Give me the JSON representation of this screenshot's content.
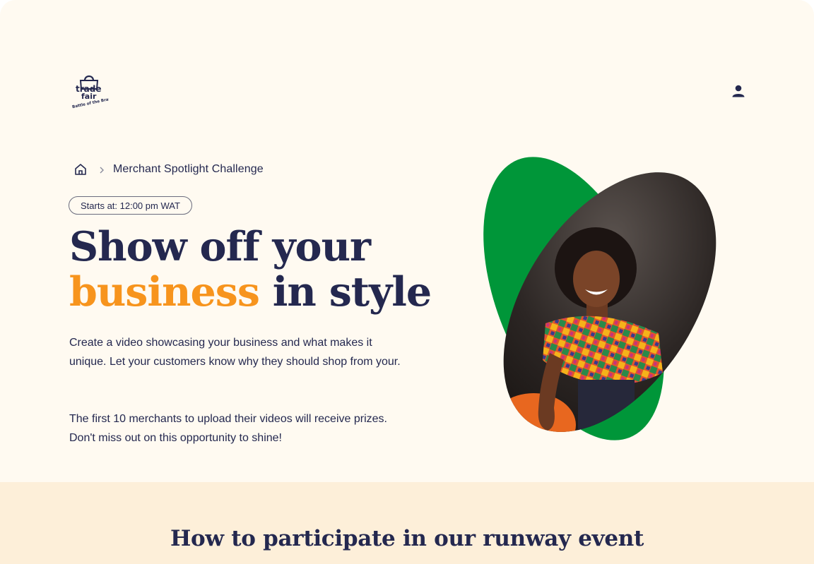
{
  "header": {
    "logo": {
      "icon": "shopping-bag-logo",
      "wordmark_line1": "trade",
      "wordmark_line2": "fair",
      "tagline": "Battle of the Brands"
    },
    "user_icon": "user-account-icon"
  },
  "breadcrumb": {
    "home_icon": "home-icon",
    "separator_icon": "chevron-right-icon",
    "current": "Merchant Spotlight Challenge"
  },
  "badge": {
    "label": "Starts at: 12:00 pm WAT"
  },
  "hero": {
    "headline_line1": "Show off your",
    "headline_accent": "business",
    "headline_rest": " in style",
    "paragraph1": "Create a video showcasing your business and what makes it unique. Let your customers know why they should shop from your.",
    "paragraph2": "The first 10 merchants to upload their videos will receive prizes. Don't miss out on this opportunity to shine!"
  },
  "how_section": {
    "title": "How to participate in our runway event"
  },
  "colors": {
    "background": "#fffaf1",
    "navy": "#24284f",
    "accent_orange": "#f7941d",
    "green": "#009639",
    "section_bg": "#fdefd9"
  }
}
